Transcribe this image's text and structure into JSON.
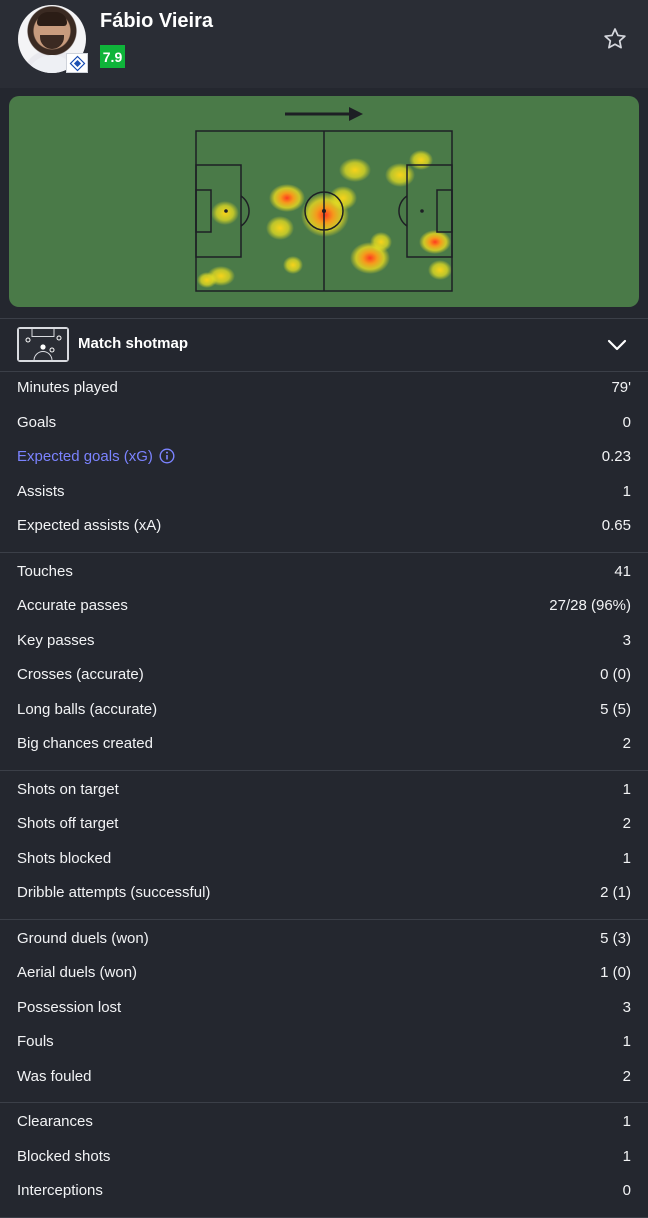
{
  "player": {
    "name": "Fábio Vieira",
    "rating": "7.9",
    "rating_color": "#0fb43a",
    "avatar_icon": "player-photo",
    "club_icon": "club-crest-icon"
  },
  "heatmap": {
    "direction_icon": "attack-direction-arrow-icon",
    "pitch_color": "#4a7a48"
  },
  "shotmap": {
    "label": "Match shotmap",
    "thumb_icon": "shotmap-thumbnail-icon",
    "toggle_icon": "chevron-down-icon"
  },
  "colors": {
    "background": "#24272f",
    "accent_link": "#7b83ff"
  },
  "stats": [
    [
      {
        "label": "Minutes played",
        "value": "79'"
      },
      {
        "label": "Goals",
        "value": "0"
      },
      {
        "label": "Expected goals (xG)",
        "value": "0.23",
        "link": true
      },
      {
        "label": "Assists",
        "value": "1"
      },
      {
        "label": "Expected assists (xA)",
        "value": "0.65"
      }
    ],
    [
      {
        "label": "Touches",
        "value": "41"
      },
      {
        "label": "Accurate passes",
        "value": "27/28 (96%)"
      },
      {
        "label": "Key passes",
        "value": "3"
      },
      {
        "label": "Crosses (accurate)",
        "value": "0 (0)"
      },
      {
        "label": "Long balls (accurate)",
        "value": "5 (5)"
      },
      {
        "label": "Big chances created",
        "value": "2"
      }
    ],
    [
      {
        "label": "Shots on target",
        "value": "1"
      },
      {
        "label": "Shots off target",
        "value": "2"
      },
      {
        "label": "Shots blocked",
        "value": "1"
      },
      {
        "label": "Dribble attempts (successful)",
        "value": "2 (1)"
      }
    ],
    [
      {
        "label": "Ground duels (won)",
        "value": "5 (3)"
      },
      {
        "label": "Aerial duels (won)",
        "value": "1 (0)"
      },
      {
        "label": "Possession lost",
        "value": "3"
      },
      {
        "label": "Fouls",
        "value": "1"
      },
      {
        "label": "Was fouled",
        "value": "2"
      }
    ],
    [
      {
        "label": "Clearances",
        "value": "1"
      },
      {
        "label": "Blocked shots",
        "value": "1"
      },
      {
        "label": "Interceptions",
        "value": "0"
      }
    ]
  ]
}
